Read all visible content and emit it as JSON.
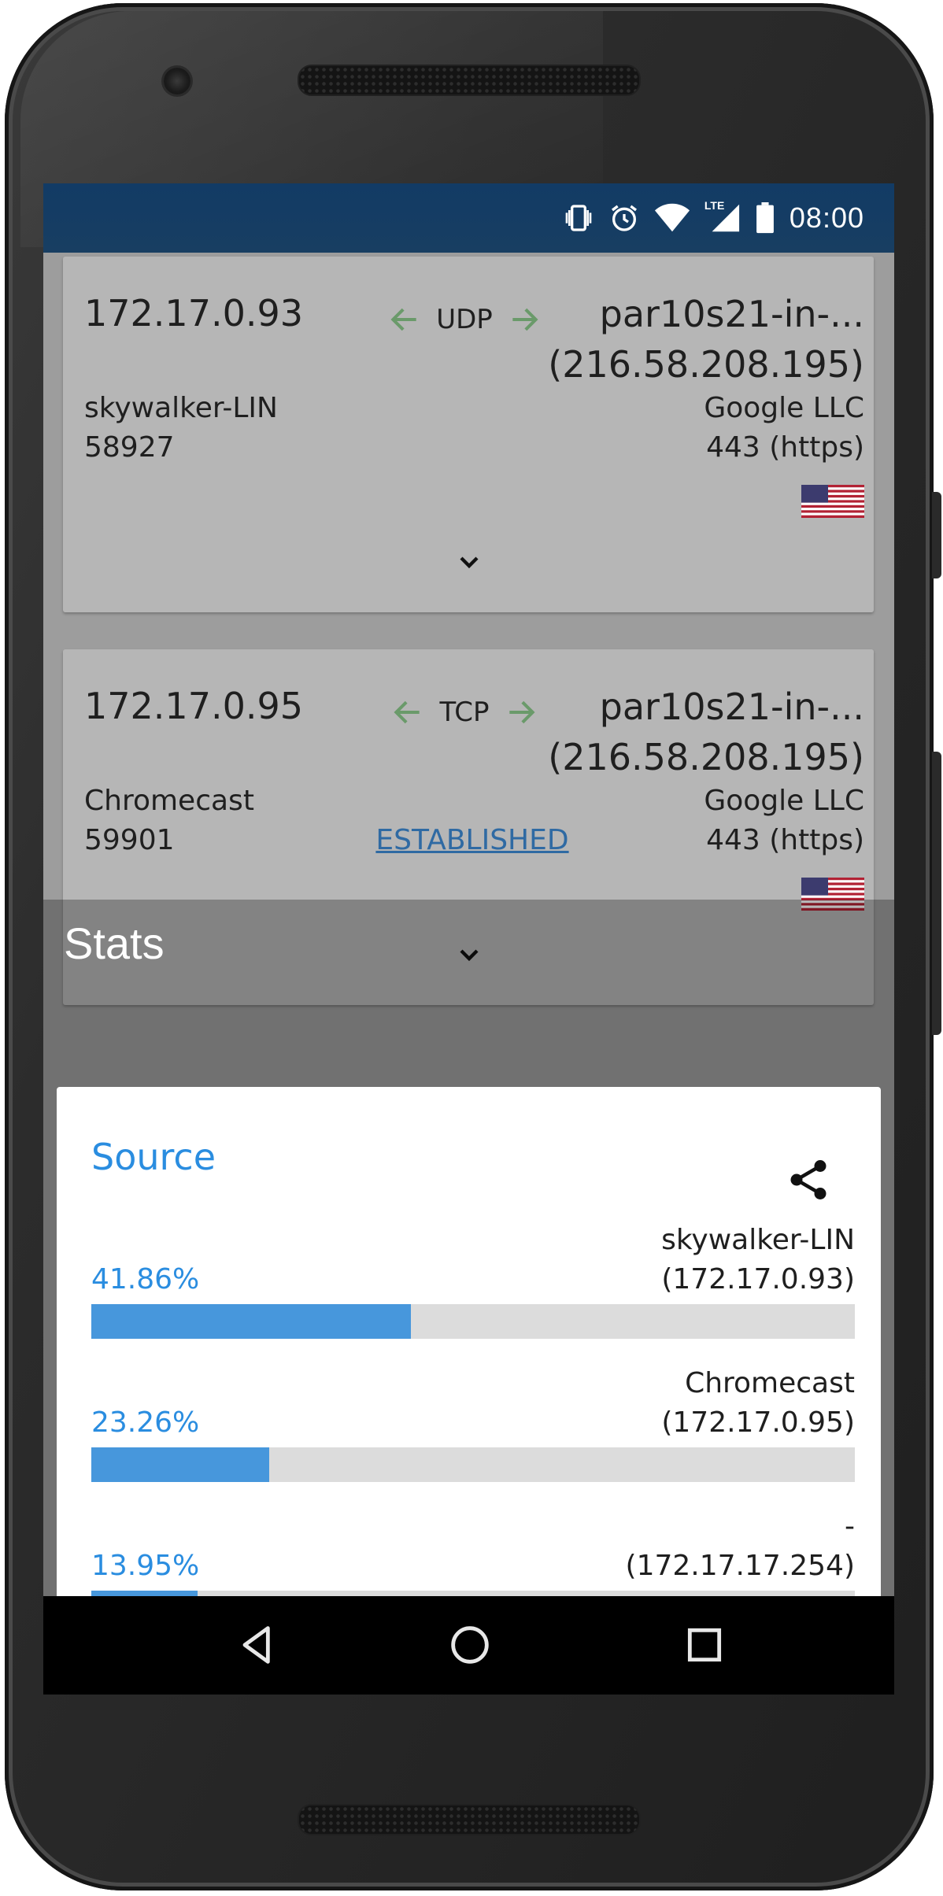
{
  "status_bar": {
    "time": "08:00",
    "icons": [
      "vibrate-icon",
      "alarm-icon",
      "wifi-icon",
      "lte-signal-icon",
      "battery-icon"
    ],
    "lte_label": "LTE",
    "background_color": "#163e64"
  },
  "connections": [
    {
      "source_ip": "172.17.0.93",
      "protocol": "UDP",
      "dest_name": "par10s21-in-...",
      "dest_ip": "(216.58.208.195)",
      "source_host": "skywalker-LIN",
      "source_port": "58927",
      "dest_org": "Google LLC",
      "dest_port": "443 (https)",
      "state": "",
      "flag": "us-flag-icon"
    },
    {
      "source_ip": "172.17.0.95",
      "protocol": "TCP",
      "dest_name": "par10s21-in-...",
      "dest_ip": "(216.58.208.195)",
      "source_host": "Chromecast",
      "source_port": "59901",
      "dest_org": "Google LLC",
      "dest_port": "443 (https)",
      "state": "ESTABLISHED",
      "flag": "us-flag-icon"
    }
  ],
  "stats": {
    "title": "Stats",
    "sheet_title": "Source",
    "share_icon": "share-icon",
    "items": [
      {
        "name": "skywalker-LIN",
        "ip": "(172.17.0.93)",
        "percent_label": "41.86%",
        "percent": 41.86
      },
      {
        "name": "Chromecast",
        "ip": "(172.17.0.95)",
        "percent_label": "23.26%",
        "percent": 23.26
      },
      {
        "name": "-",
        "ip": "(172.17.17.254)",
        "percent_label": "13.95%",
        "percent": 13.95
      }
    ]
  },
  "colors": {
    "accent": "#2a8de0",
    "bar_fill": "#4797dc",
    "bar_track": "#dcdcdc",
    "arrow": "#6a9a6a",
    "link": "#2f6aa3"
  },
  "nav_bar": {
    "buttons": [
      "back-icon",
      "home-icon",
      "recents-icon"
    ]
  }
}
